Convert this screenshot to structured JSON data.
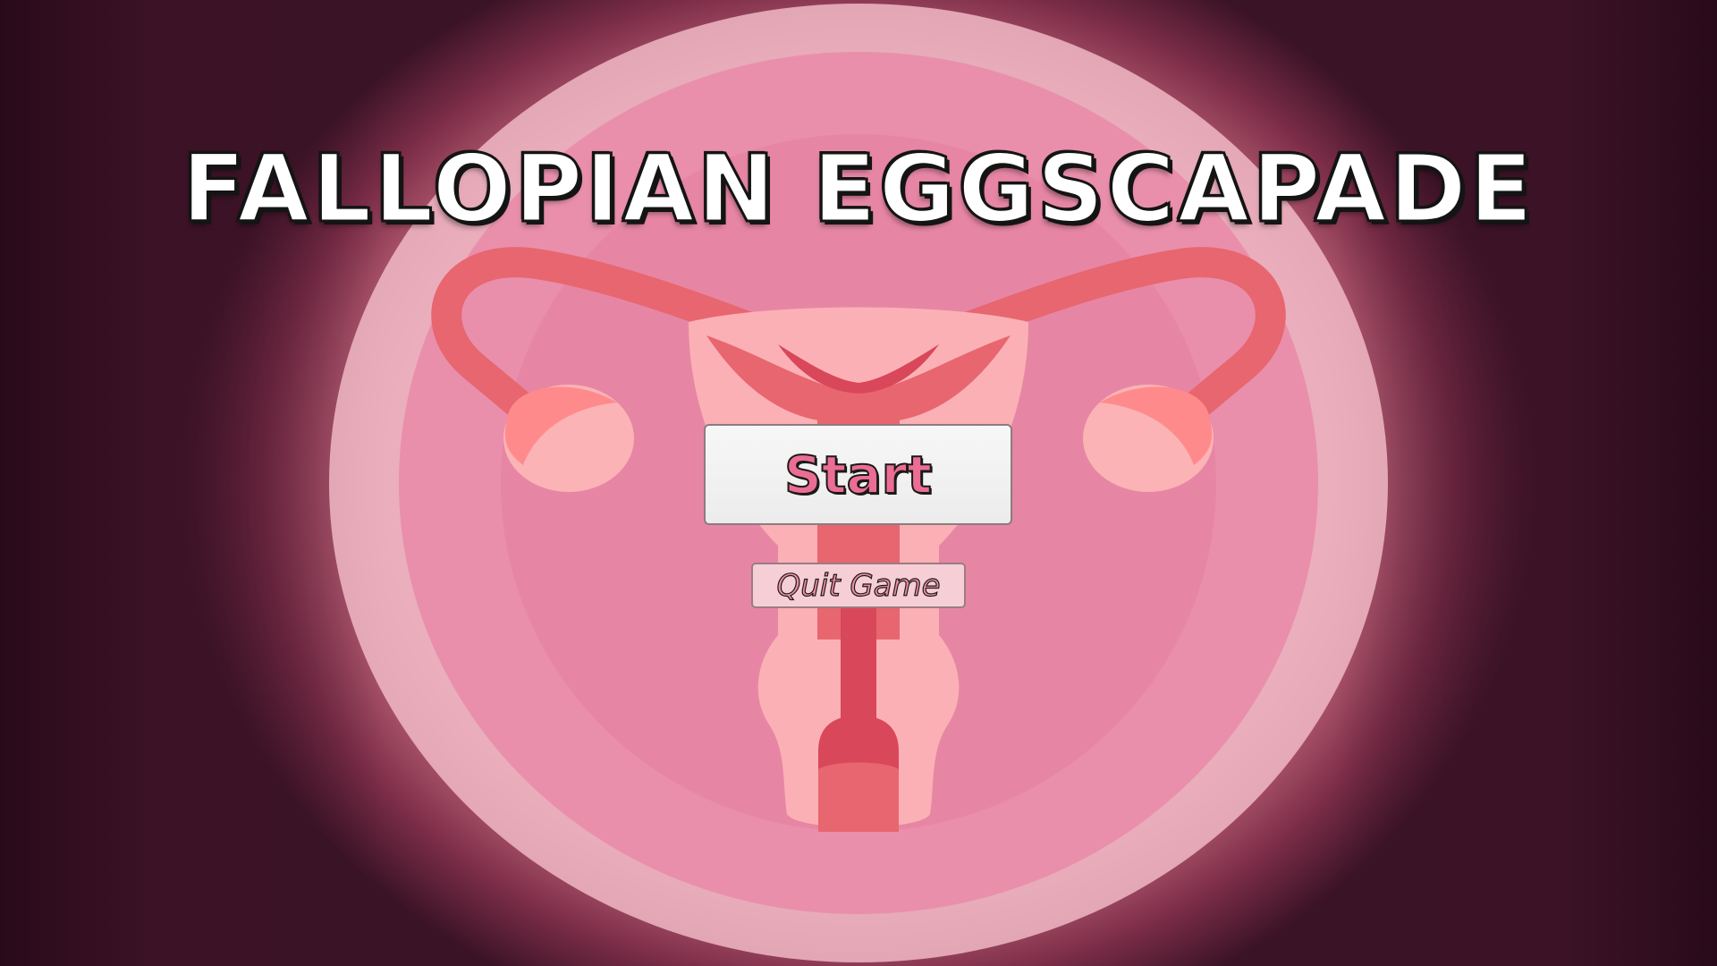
{
  "game": {
    "title": "FALLOPIAN EGGSCAPADE"
  },
  "menu": {
    "start_label": "Start",
    "quit_label": "Quit Game"
  },
  "artwork": {
    "subject": "uterus-illustration",
    "colors": {
      "ring": "#f0b5c3",
      "inner_circle": "#e98aa7",
      "organ_light": "#fbb3b6",
      "organ_mid": "#e8666f",
      "organ_dark": "#d9475a",
      "title_fill": "#ffffff",
      "start_text": "#ec6d94",
      "quit_text": "#f08ba5"
    }
  }
}
